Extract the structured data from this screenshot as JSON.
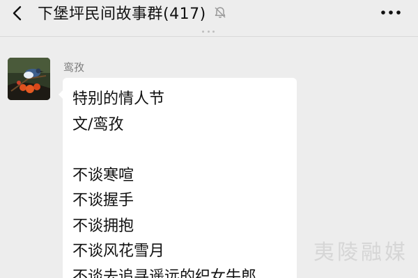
{
  "header": {
    "title": "下堡坪民间故事群(417)",
    "back_icon": "chevron-left-icon",
    "mute_icon": "bell-muted-icon",
    "more_icon": "more-horizontal-icon"
  },
  "message": {
    "sender": "鸾孜",
    "lines": [
      "特别的情人节",
      "文/鸾孜",
      "",
      "不谈寒喧",
      "不谈握手",
      "不谈拥抱",
      "不谈风花雪月",
      "不谈去追寻遥远的织女牛郎"
    ]
  },
  "watermark": "夷陵融媒",
  "colors": {
    "background": "#ededed",
    "bubble": "#ffffff",
    "text": "#111111",
    "sender": "#7a7a7a"
  }
}
